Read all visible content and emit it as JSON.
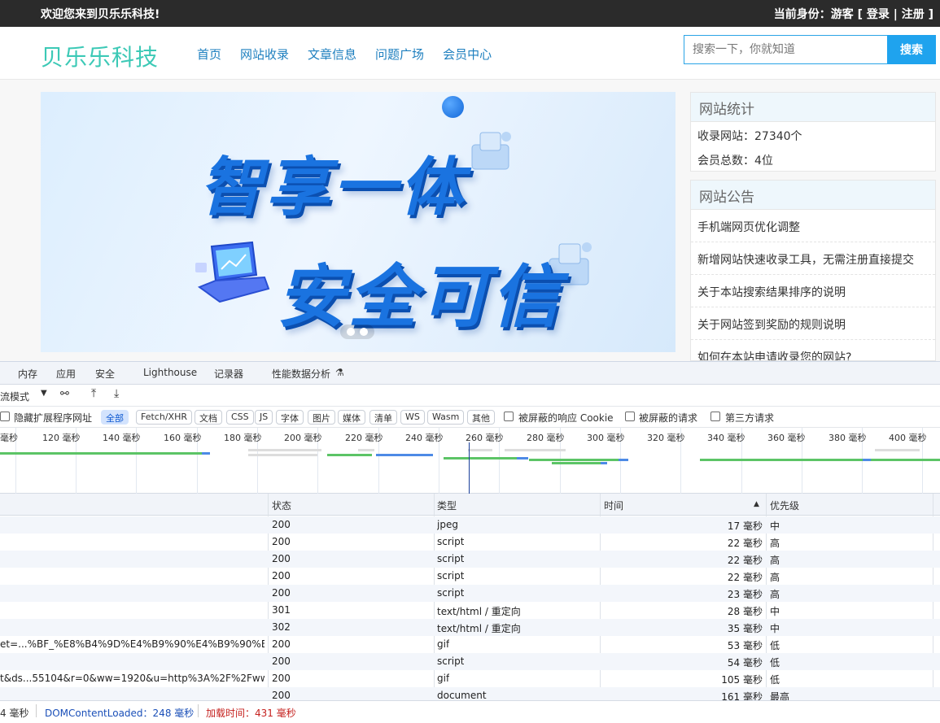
{
  "topbar": {
    "welcome": "欢迎您来到贝乐乐科技!",
    "identity": "当前身份：游客 [ 登录 | 注册 ]"
  },
  "header": {
    "logo": "贝乐乐科技",
    "nav": [
      "首页",
      "网站收录",
      "文章信息",
      "问题广场",
      "会员中心"
    ],
    "search_placeholder": "搜索一下，你就知道",
    "search_button": "搜索"
  },
  "banner": {
    "line1": "智享一体",
    "line2": "安全可信"
  },
  "sidebar": {
    "stats_title": "网站统计",
    "stats": [
      "收录网站：27340个",
      "会员总数：4位"
    ],
    "notice_title": "网站公告",
    "notices": [
      "手机端网页优化调整",
      "新增网站快速收录工具，无需注册直接提交",
      "关于本站搜索结果排序的说明",
      "关于网站签到奖励的规则说明",
      "如何在本站申请收录您的网站?"
    ]
  },
  "devtools": {
    "tabs": [
      "内存",
      "应用",
      "安全",
      "Lighthouse",
      "记录器",
      "性能数据分析"
    ],
    "throttle": "流模式",
    "hide_ext": "隐藏扩展程序网址",
    "filters": [
      "全部",
      "Fetch/XHR",
      "文档",
      "CSS",
      "JS",
      "字体",
      "图片",
      "媒体",
      "清单",
      "WS",
      "Wasm",
      "其他"
    ],
    "blocked_cookie": "被屏蔽的响应 Cookie",
    "blocked_req": "被屏蔽的请求",
    "third_party": "第三方请求",
    "ticks": [
      "毫秒",
      "120 毫秒",
      "140 毫秒",
      "160 毫秒",
      "180 毫秒",
      "200 毫秒",
      "220 毫秒",
      "240 毫秒",
      "260 毫秒",
      "280 毫秒",
      "300 毫秒",
      "320 毫秒",
      "340 毫秒",
      "360 毫秒",
      "380 毫秒",
      "400 毫秒"
    ],
    "headers": {
      "status": "状态",
      "type": "类型",
      "time": "时间",
      "priority": "优先级"
    },
    "rows": [
      {
        "name": "",
        "status": "200",
        "type": "jpeg",
        "time": "17 毫秒",
        "priority": "中"
      },
      {
        "name": "",
        "status": "200",
        "type": "script",
        "time": "22 毫秒",
        "priority": "高"
      },
      {
        "name": "",
        "status": "200",
        "type": "script",
        "time": "22 毫秒",
        "priority": "高"
      },
      {
        "name": "",
        "status": "200",
        "type": "script",
        "time": "22 毫秒",
        "priority": "高"
      },
      {
        "name": "",
        "status": "200",
        "type": "script",
        "time": "23 毫秒",
        "priority": "高"
      },
      {
        "name": "",
        "status": "301",
        "type": "text/html / 重定向",
        "time": "28 毫秒",
        "priority": "中"
      },
      {
        "name": "",
        "status": "302",
        "type": "text/html / 重定向",
        "time": "35 毫秒",
        "priority": "中"
      },
      {
        "name": "et=...%BF_%E8%B4%9D%E4%B9%90%E4%B9%90%E7...",
        "status": "200",
        "type": "gif",
        "time": "53 毫秒",
        "priority": "低"
      },
      {
        "name": "",
        "status": "200",
        "type": "script",
        "time": "54 毫秒",
        "priority": "低"
      },
      {
        "name": "t&ds...55104&r=0&ww=1920&u=http%3A%2F%2Fww...",
        "status": "200",
        "type": "gif",
        "time": "105 毫秒",
        "priority": "低"
      },
      {
        "name": "",
        "status": "200",
        "type": "document",
        "time": "161 毫秒",
        "priority": "最高"
      }
    ],
    "status_finish": "4 毫秒",
    "status_dcl": "DOMContentLoaded：248 毫秒",
    "status_load": "加载时间：431 毫秒"
  }
}
